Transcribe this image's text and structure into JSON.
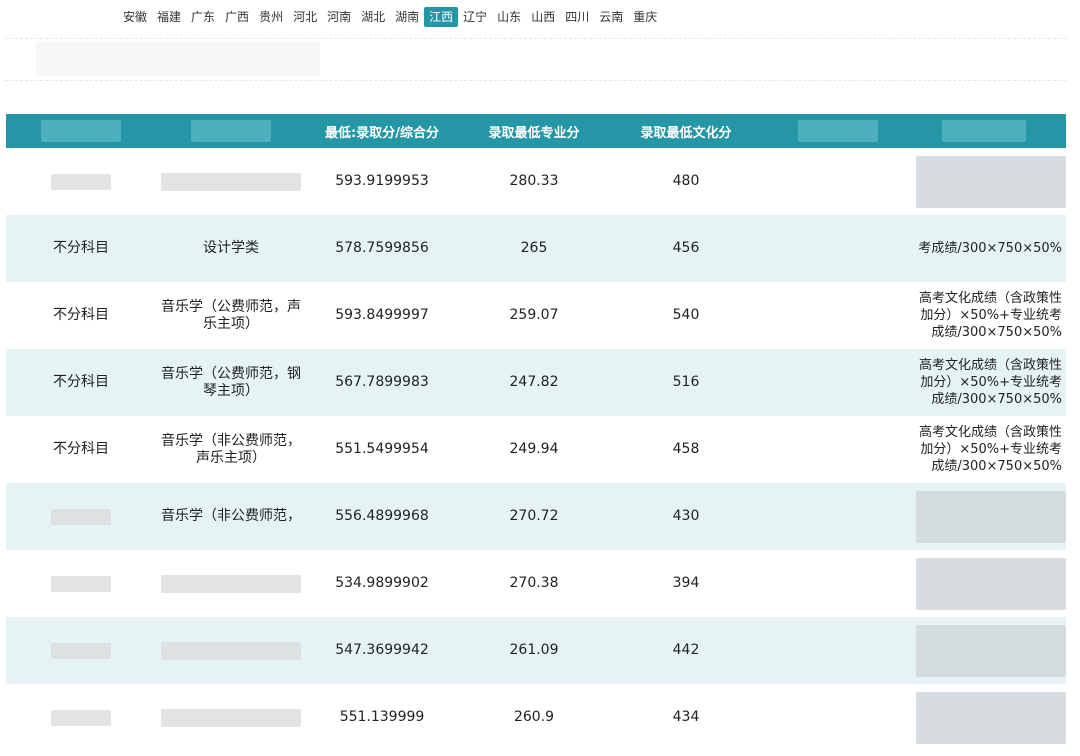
{
  "provinces": [
    {
      "label": "安徽",
      "active": false
    },
    {
      "label": "福建",
      "active": false
    },
    {
      "label": "广东",
      "active": false
    },
    {
      "label": "广西",
      "active": false
    },
    {
      "label": "贵州",
      "active": false
    },
    {
      "label": "河北",
      "active": false
    },
    {
      "label": "河南",
      "active": false
    },
    {
      "label": "湖北",
      "active": false
    },
    {
      "label": "湖南",
      "active": false
    },
    {
      "label": "江西",
      "active": true
    },
    {
      "label": "辽宁",
      "active": false
    },
    {
      "label": "山东",
      "active": false
    },
    {
      "label": "山西",
      "active": false
    },
    {
      "label": "四川",
      "active": false
    },
    {
      "label": "云南",
      "active": false
    },
    {
      "label": "重庆",
      "active": false
    }
  ],
  "table": {
    "headers": [
      "",
      "",
      "最低:录取分/综合分",
      "录取最低专业分",
      "录取最低文化分",
      "",
      ""
    ],
    "rows": [
      {
        "subject": "",
        "major": "",
        "composite": "593.9199953",
        "major_score": "280.33",
        "culture_score": "480",
        "formula": ""
      },
      {
        "subject": "不分科目",
        "major": "设计学类",
        "composite": "578.7599856",
        "major_score": "265",
        "culture_score": "456",
        "formula": "考成绩/300×750×50%"
      },
      {
        "subject": "不分科目",
        "major": "音乐学（公费师范，声乐主项）",
        "composite": "593.8499997",
        "major_score": "259.07",
        "culture_score": "540",
        "formula": "高考文化成绩（含政策性加分）×50%+专业统考成绩/300×750×50%"
      },
      {
        "subject": "不分科目",
        "major": "音乐学（公费师范，钢琴主项）",
        "composite": "567.7899983",
        "major_score": "247.82",
        "culture_score": "516",
        "formula": "高考文化成绩（含政策性加分）×50%+专业统考成绩/300×750×50%"
      },
      {
        "subject": "不分科目",
        "major": "音乐学（非公费师范，声乐主项）",
        "composite": "551.5499954",
        "major_score": "249.94",
        "culture_score": "458",
        "formula": "高考文化成绩（含政策性加分）×50%+专业统考成绩/300×750×50%"
      },
      {
        "subject": "",
        "major": "音乐学（非公费师范，",
        "composite": "556.4899968",
        "major_score": "270.72",
        "culture_score": "430",
        "formula": ""
      },
      {
        "subject": "",
        "major": "",
        "composite": "534.9899902",
        "major_score": "270.38",
        "culture_score": "394",
        "formula": ""
      },
      {
        "subject": "",
        "major": "",
        "composite": "547.3699942",
        "major_score": "261.09",
        "culture_score": "442",
        "formula": ""
      },
      {
        "subject": "",
        "major": "",
        "composite": "551.139999",
        "major_score": "260.9",
        "culture_score": "434",
        "formula": ""
      }
    ]
  }
}
